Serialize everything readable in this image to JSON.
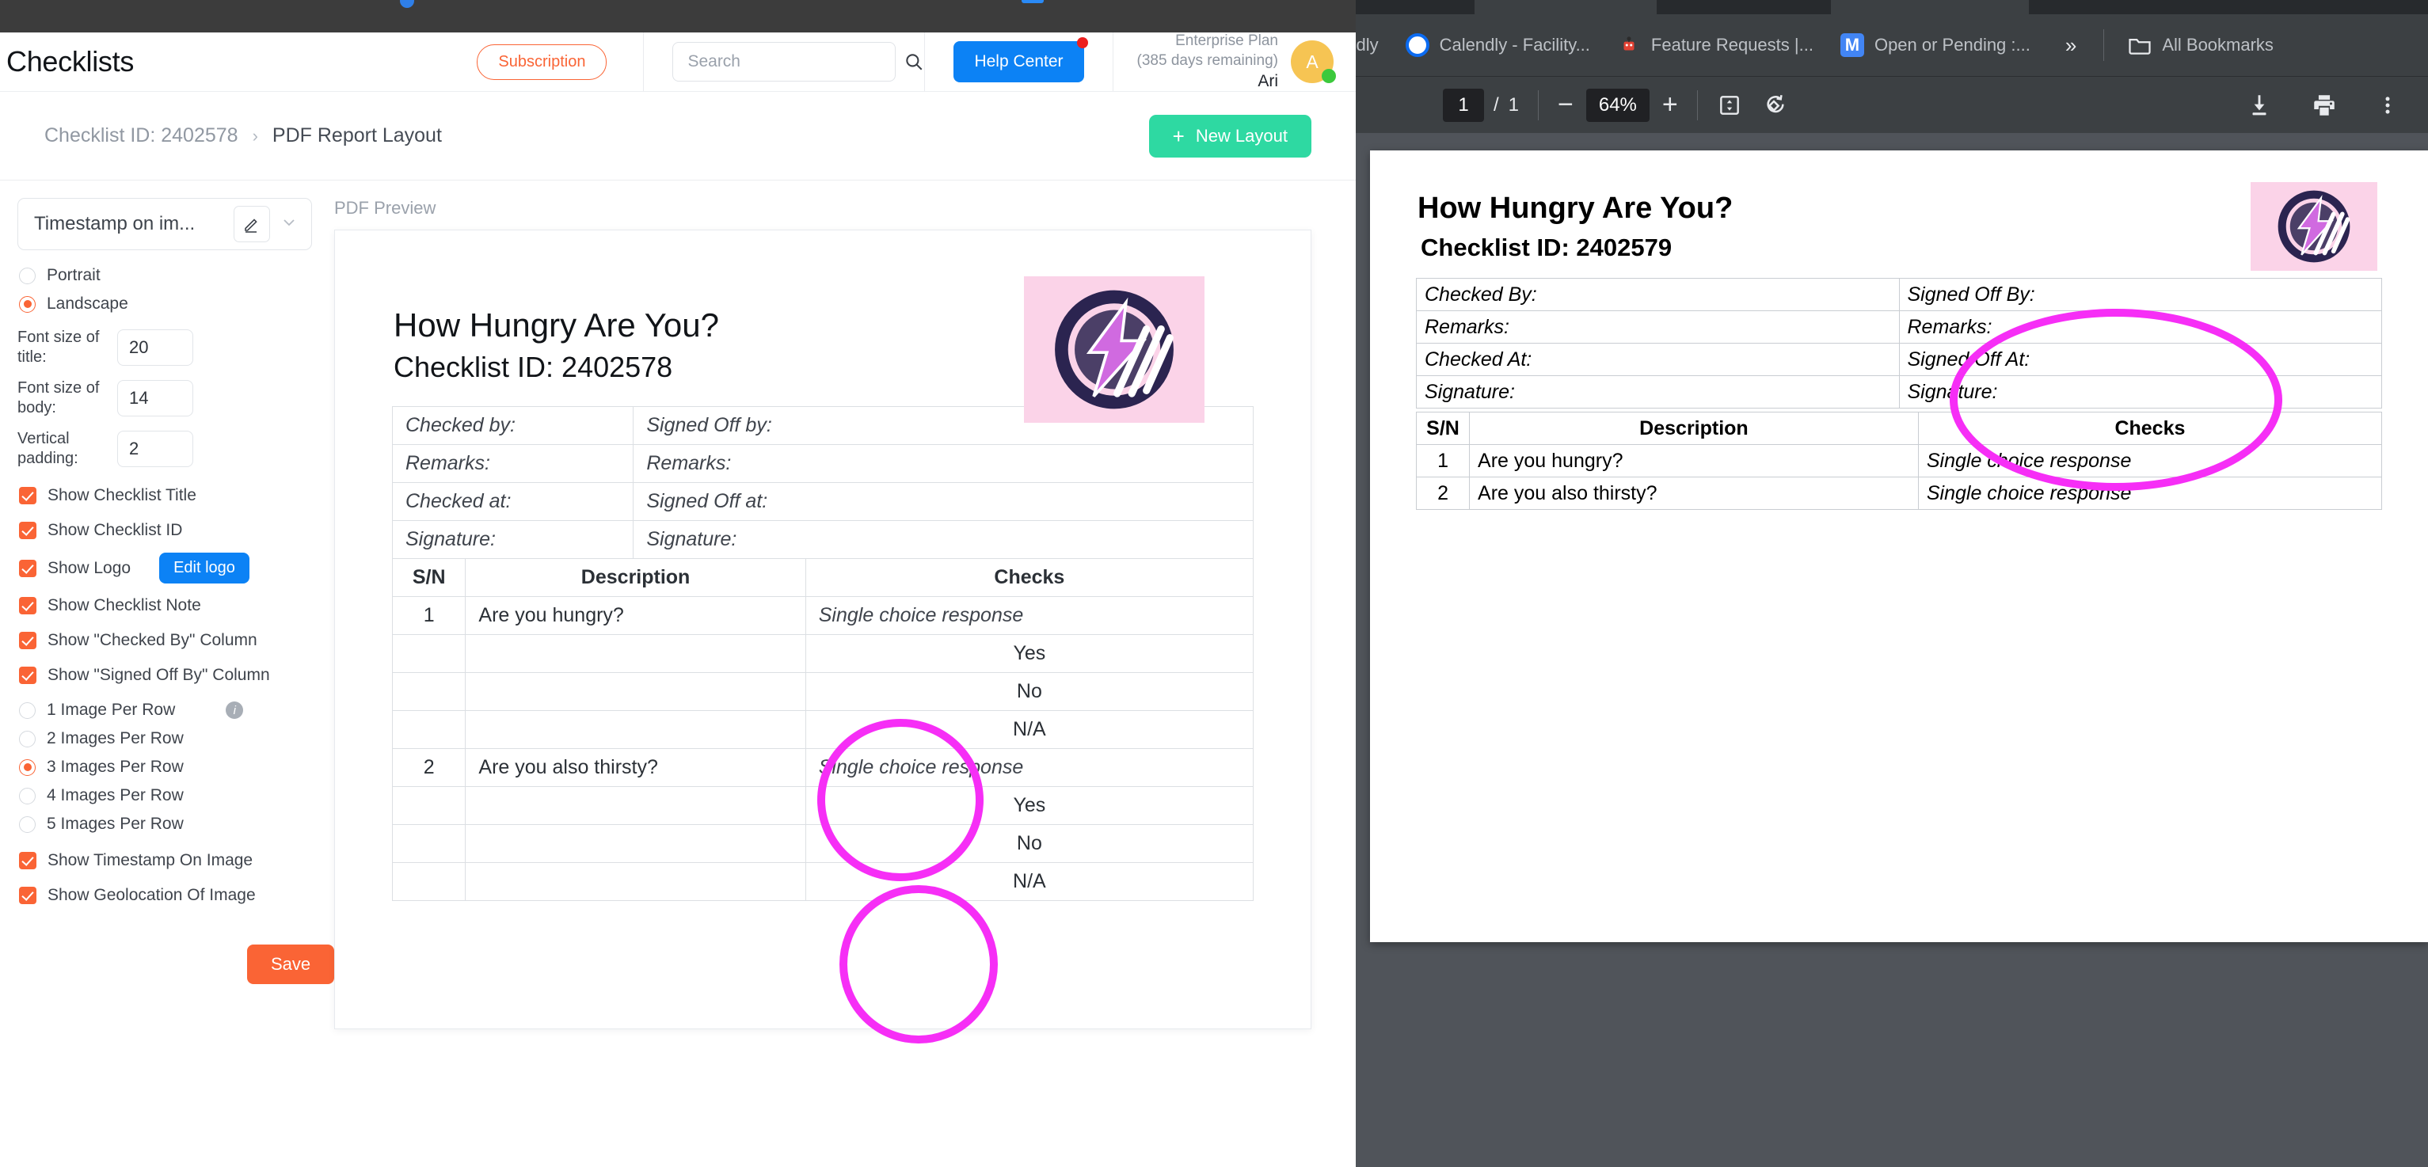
{
  "app": {
    "title": "Checklists",
    "subscription_label": "Subscription",
    "search": {
      "placeholder": "Search",
      "value": ""
    },
    "help_label": "Help Center",
    "plan_name": "Enterprise Plan",
    "plan_days": "(385 days remaining)",
    "user_name": "Ari",
    "avatar_initial": "A"
  },
  "breadcrumb": {
    "parent": "Checklist ID: 2402578",
    "separator": "›",
    "current": "PDF Report Layout",
    "new_layout_label": "New Layout",
    "plus": "+"
  },
  "settings": {
    "layout_name": "Timestamp on im...",
    "orientation": [
      {
        "label": "Portrait",
        "selected": false
      },
      {
        "label": "Landscape",
        "selected": true
      }
    ],
    "fields": [
      {
        "label": "Font size of title:",
        "value": "20"
      },
      {
        "label": "Font size of body:",
        "value": "14"
      },
      {
        "label": "Vertical padding:",
        "value": "2"
      }
    ],
    "checkboxes": [
      {
        "label": "Show Checklist Title",
        "checked": true
      },
      {
        "label": "Show Checklist ID",
        "checked": true
      },
      {
        "label": "Show Logo",
        "checked": true,
        "button": "Edit logo"
      },
      {
        "label": "Show Checklist Note",
        "checked": true
      },
      {
        "label": "Show \"Checked By\" Column",
        "checked": true
      },
      {
        "label": "Show \"Signed Off By\" Column",
        "checked": true
      }
    ],
    "images_per_row": [
      {
        "label": "1 Image Per Row",
        "selected": false
      },
      {
        "label": "2 Images Per Row",
        "selected": false
      },
      {
        "label": "3 Images Per Row",
        "selected": true
      },
      {
        "label": "4 Images Per Row",
        "selected": false
      },
      {
        "label": "5 Images Per Row",
        "selected": false
      }
    ],
    "trailing_checkboxes": [
      {
        "label": "Show Timestamp On Image",
        "checked": true
      },
      {
        "label": "Show Geolocation Of Image",
        "checked": true
      }
    ],
    "save_label": "Save"
  },
  "preview": {
    "label": "PDF Preview",
    "doc_title": "How Hungry Are You?",
    "doc_subtitle": "Checklist ID: 2402578",
    "meta_left": [
      "Checked by:",
      "Remarks:",
      "Checked at:",
      "Signature:"
    ],
    "meta_right": [
      "Signed Off by:",
      "Remarks:",
      "Signed Off at:",
      "Signature:"
    ],
    "columns": [
      "S/N",
      "Description",
      "Checks"
    ],
    "rows": [
      {
        "sn": "1",
        "description": "Are you hungry?",
        "checks": "Single choice response",
        "options": [
          "Yes",
          "No",
          "N/A"
        ]
      },
      {
        "sn": "2",
        "description": "Are you also thirsty?",
        "checks": "Single choice response",
        "options": [
          "Yes",
          "No",
          "N/A"
        ]
      }
    ]
  },
  "browser": {
    "bookmarks": [
      {
        "label": "endly",
        "icon": "calendly-icon"
      },
      {
        "label": "Calendly - Facility...",
        "icon": "calendly-icon"
      },
      {
        "label": "Feature Requests |...",
        "icon": "feature-icon"
      },
      {
        "label": "Open or Pending :...",
        "icon": "missive-icon"
      }
    ],
    "overflow": "»",
    "all_bookmarks": "All Bookmarks"
  },
  "pdf_viewer": {
    "page_current": "1",
    "page_separator": "/",
    "page_total": "1",
    "zoom_out": "−",
    "zoom_level": "64%",
    "zoom_in": "+",
    "fit_icon": "fit-page-icon",
    "rotate_icon": "rotate-icon",
    "download_icon": "download-icon",
    "print_icon": "print-icon",
    "more_icon": "more-vertical-icon"
  },
  "pdf_document": {
    "title": "How Hungry Are You?",
    "subtitle": "Checklist ID: 2402579",
    "meta_left": [
      "Checked By:",
      "Remarks:",
      "Checked At:",
      "Signature:"
    ],
    "meta_right": [
      "Signed Off By:",
      "Remarks:",
      "Signed Off At:",
      "Signature:"
    ],
    "columns": [
      "S/N",
      "Description",
      "Checks"
    ],
    "rows": [
      {
        "sn": "1",
        "description": "Are you hungry?",
        "checks": "Single choice response"
      },
      {
        "sn": "2",
        "description": "Are you also thirsty?",
        "checks": "Single choice response"
      }
    ]
  },
  "colors": {
    "accent_orange": "#fa6435",
    "blue": "#0c82f5",
    "green": "#2ed9a2",
    "annotation_magenta": "#f62ef6"
  }
}
